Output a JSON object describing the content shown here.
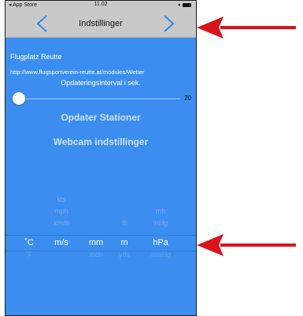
{
  "statusbar": {
    "carrier": "◂ App Store",
    "time": "11.02",
    "right": "◂"
  },
  "navbar": {
    "title": "Indstillinger"
  },
  "station": {
    "name": "Flugplatz Reutte",
    "url": "http://www.flugsportverein-reutte.at/modules/Wetter"
  },
  "interval": {
    "label": "Opdateringsinterval i sek.",
    "value": "20",
    "level": 0
  },
  "buttons": {
    "update": "Opdater Stationer",
    "webcam": "Webcam indstillinger"
  },
  "picker": {
    "columns": [
      {
        "items": [
          "",
          "",
          "",
          "˚C",
          "˚F"
        ],
        "selected": "˚C"
      },
      {
        "items": [
          "kts",
          "mph",
          "km/h",
          "m/s",
          ""
        ],
        "selected": "m/s"
      },
      {
        "items": [
          "",
          "",
          "",
          "mm",
          "inch"
        ],
        "selected": "mm"
      },
      {
        "items": [
          "",
          "",
          "ft",
          "m",
          "yds"
        ],
        "selected": "m"
      },
      {
        "items": [
          "",
          "mb",
          "inHg",
          "hPa",
          "mmHg"
        ],
        "selected": "hPa"
      }
    ]
  },
  "colors": {
    "background": "#3b8ef0",
    "navbar": "#c9c9c9",
    "arrow": "#d9141b",
    "chevron": "#2f86f0"
  },
  "icons": {
    "back": "chevron-left-icon",
    "forward": "chevron-right-icon",
    "annotation": "red-arrow-icon"
  }
}
